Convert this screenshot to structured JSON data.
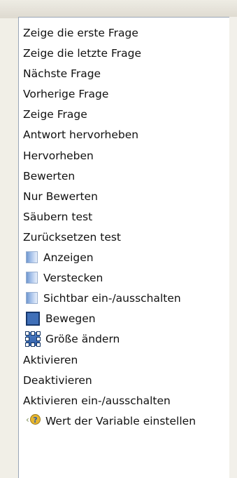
{
  "menu": {
    "items": [
      {
        "label": "Zeige die erste Frage",
        "icon": null
      },
      {
        "label": "Zeige die letzte Frage",
        "icon": null
      },
      {
        "label": "Nächste Frage",
        "icon": null
      },
      {
        "label": "Vorherige Frage",
        "icon": null
      },
      {
        "label": "Zeige Frage",
        "icon": null
      },
      {
        "label": "Antwort hervorheben",
        "icon": null
      },
      {
        "label": "Hervorheben",
        "icon": null
      },
      {
        "label": "Bewerten",
        "icon": null
      },
      {
        "label": "Nur Bewerten",
        "icon": null
      },
      {
        "label": "Säubern test",
        "icon": null
      },
      {
        "label": "Zurücksetzen test",
        "icon": null
      },
      {
        "label": "Anzeigen",
        "icon": "blue-square-icon"
      },
      {
        "label": "Verstecken",
        "icon": "blue-square-icon"
      },
      {
        "label": "Sichtbar ein-/ausschalten",
        "icon": "blue-square-icon"
      },
      {
        "label": "Bewegen",
        "icon": "move-icon"
      },
      {
        "label": "Größe ändern",
        "icon": "resize-icon"
      },
      {
        "label": "Aktivieren",
        "icon": null
      },
      {
        "label": "Deaktivieren",
        "icon": null
      },
      {
        "label": "Aktivieren ein-/ausschalten",
        "icon": null
      },
      {
        "label": "Wert der Variable einstellen",
        "icon": "variable-question-icon"
      }
    ]
  },
  "colors": {
    "panel_background": "#ffffff",
    "panel_border": "#9aa6b7",
    "icon_blue": "#3f6fb8",
    "icon_gold": "#e6b530",
    "text": "#111111"
  }
}
